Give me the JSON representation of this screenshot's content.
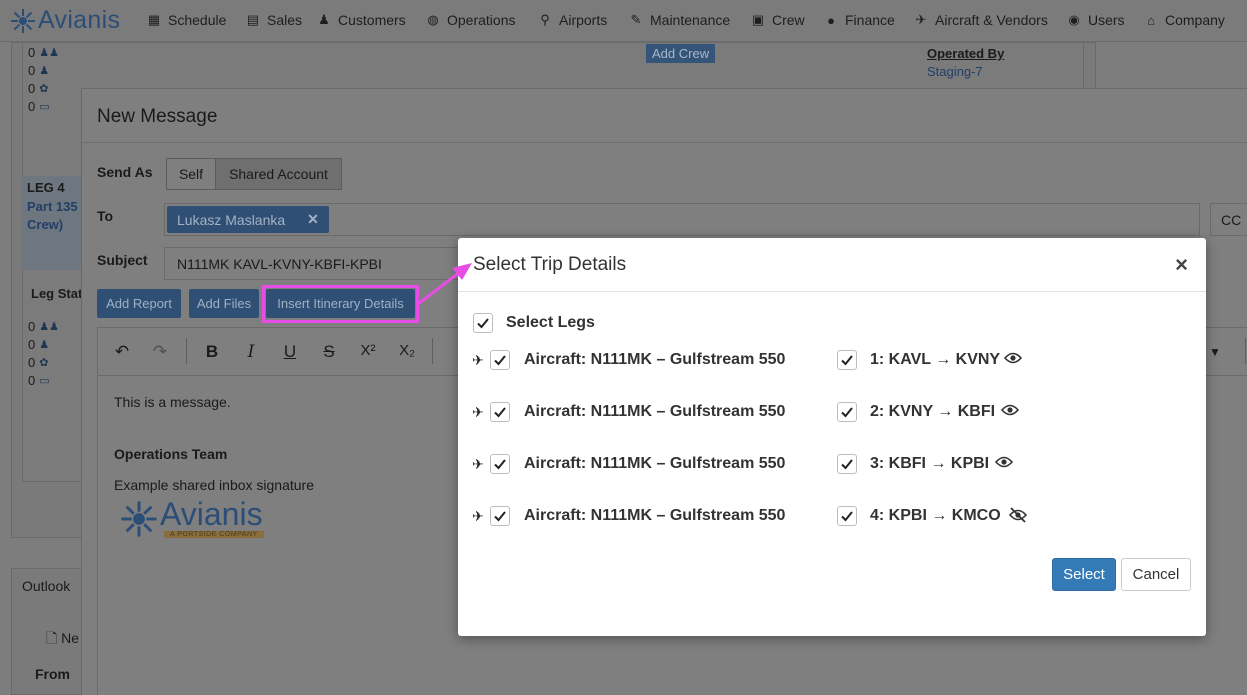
{
  "nav": {
    "logo": "Avianis",
    "items": [
      {
        "label": "Schedule",
        "icon": "calendar-icon"
      },
      {
        "label": "Sales",
        "icon": "document-icon"
      },
      {
        "label": "Customers",
        "icon": "users-icon"
      },
      {
        "label": "Operations",
        "icon": "globe-icon"
      },
      {
        "label": "Airports",
        "icon": "map-pin-icon"
      },
      {
        "label": "Maintenance",
        "icon": "wrench-icon"
      },
      {
        "label": "Crew",
        "icon": "id-card-icon"
      },
      {
        "label": "Finance",
        "icon": "dollar-icon"
      },
      {
        "label": "Aircraft & Vendors",
        "icon": "plane-icon"
      },
      {
        "label": "Users",
        "icon": "user-circle-icon"
      },
      {
        "label": "Company",
        "icon": "building-icon"
      }
    ]
  },
  "background": {
    "counts_top": [
      "0",
      "0",
      "0",
      "0"
    ],
    "counts_bottom": [
      "0",
      "0",
      "0",
      "0"
    ],
    "leg_label": "LEG 4",
    "leg_part": "Part 135",
    "leg_crew": "Crew)",
    "leg_status": "Leg Stat",
    "add_crew": "Add Crew",
    "operated_by_label": "Operated By",
    "operated_by_value": "Staging-7",
    "outlook_tab": "Outlook",
    "from_header": "From",
    "new_button_partial": "Ne"
  },
  "message": {
    "title": "New Message",
    "send_as_label": "Send As",
    "send_as_options": [
      "Self",
      "Shared Account"
    ],
    "to_label": "To",
    "to_recipient": "Lukasz Maslanka",
    "cc_label": "CC",
    "subject_label": "Subject",
    "subject_value": "N111MK KAVL-KVNY-KBFI-KPBI",
    "actions": {
      "add_report": "Add Report",
      "add_files": "Add Files",
      "insert_itinerary": "Insert Itinerary Details"
    },
    "body": {
      "line1": "This is a message.",
      "team": "Operations Team",
      "signature": "Example shared inbox signature",
      "sig_logo": "Avianis",
      "sig_tagline": "A PORTSIDE COMPANY"
    }
  },
  "dialog": {
    "title": "Select Trip Details",
    "select_legs_label": "Select Legs",
    "aircraft_rows": [
      "Aircraft: N111MK – Gulfstream 550",
      "Aircraft: N111MK – Gulfstream 550",
      "Aircraft: N111MK – Gulfstream 550",
      "Aircraft: N111MK – Gulfstream 550"
    ],
    "legs": [
      {
        "label": "1: KAVL → KVNY",
        "visible": true
      },
      {
        "label": "2: KVNY → KBFI",
        "visible": true
      },
      {
        "label": "3: KBFI → KPBI",
        "visible": true
      },
      {
        "label": "4: KPBI → KMCO",
        "visible": false
      }
    ],
    "select_button": "Select",
    "cancel_button": "Cancel"
  },
  "colors": {
    "primary": "#337ab7",
    "annotation": "#e64de5",
    "brand": "#2b4e78"
  }
}
